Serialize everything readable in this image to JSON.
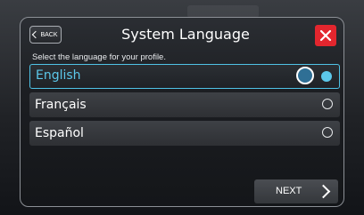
{
  "header": {
    "back_label": "BACK",
    "title": "System Language"
  },
  "subtitle": "Select the language for your profile.",
  "languages": [
    {
      "label": "English",
      "selected": true
    },
    {
      "label": "Français",
      "selected": false
    },
    {
      "label": "Español",
      "selected": false
    }
  ],
  "footer": {
    "next_label": "NEXT"
  },
  "colors": {
    "accent": "#5cc8ea",
    "close": "#e3262e",
    "selection_border": "#4fc3e6"
  },
  "icons": {
    "back": "chevron-left-icon",
    "close": "close-icon",
    "next": "chevron-right-icon",
    "radio_on": "radio-selected-icon",
    "radio_off": "radio-unselected-icon"
  }
}
